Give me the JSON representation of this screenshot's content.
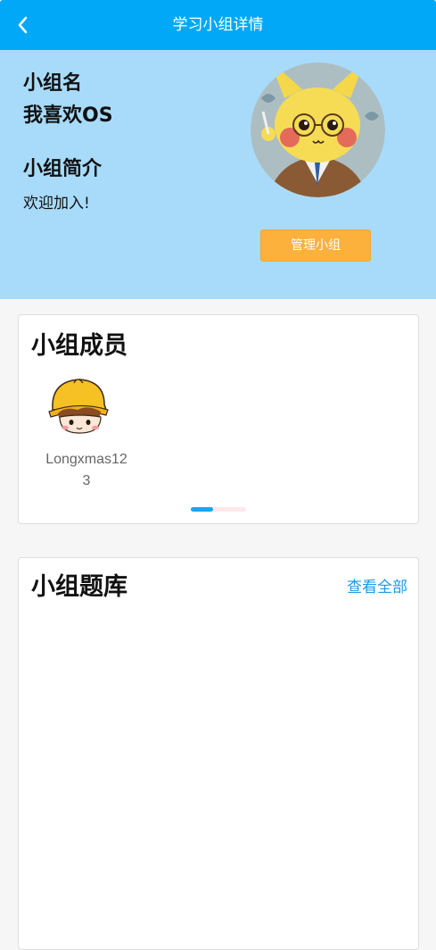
{
  "nav": {
    "title": "学习小组详情",
    "back_icon": "chevron-left-icon"
  },
  "group": {
    "name_label": "小组名",
    "name": "我喜欢OS",
    "intro_label": "小组简介",
    "intro": "欢迎加入!",
    "manage_button": "管理小组"
  },
  "members": {
    "title": "小组成员",
    "items": [
      {
        "name": "Longxmas123"
      }
    ]
  },
  "question_bank": {
    "title": "小组题库",
    "view_all": "查看全部"
  },
  "colors": {
    "nav_bg": "#00a8f7",
    "header_bg": "#a8dbfa",
    "accent_button": "#fbb13c",
    "link": "#1a9be6"
  }
}
